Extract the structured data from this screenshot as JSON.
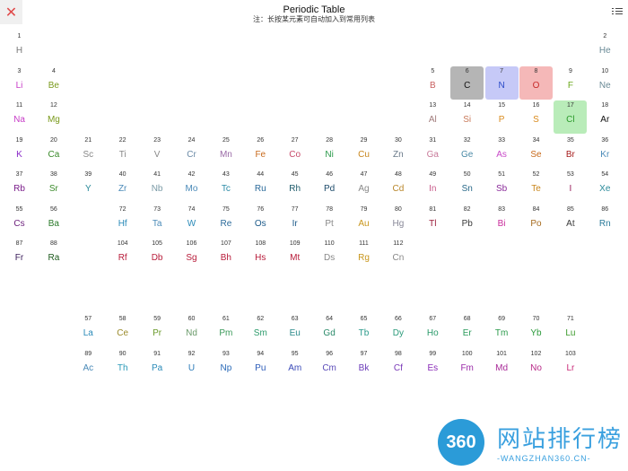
{
  "header": {
    "title": "Periodic Table",
    "subtitle": "注：长按某元素可自动加入到常用列表",
    "close_icon": "close-icon",
    "list_icon": "list-icon"
  },
  "watermark": {
    "logo_text": "360",
    "text": "网站排行榜",
    "sub": "-WANGZHAN360.CN-"
  },
  "elements": [
    {
      "n": "1",
      "s": "H",
      "row": 1,
      "col": 1,
      "color": "#777777"
    },
    {
      "n": "2",
      "s": "He",
      "row": 1,
      "col": 18,
      "color": "#6a8a96"
    },
    {
      "n": "3",
      "s": "Li",
      "row": 2,
      "col": 1,
      "color": "#c73cc7"
    },
    {
      "n": "4",
      "s": "Be",
      "row": 2,
      "col": 2,
      "color": "#7a9a1c"
    },
    {
      "n": "5",
      "s": "B",
      "row": 2,
      "col": 13,
      "color": "#c96060"
    },
    {
      "n": "6",
      "s": "C",
      "row": 2,
      "col": 14,
      "color": "#111111",
      "bg": "#b5b5b5"
    },
    {
      "n": "7",
      "s": "N",
      "row": 2,
      "col": 15,
      "color": "#2a4ac8",
      "bg": "#c6c9f7"
    },
    {
      "n": "8",
      "s": "O",
      "row": 2,
      "col": 16,
      "color": "#c82a2a",
      "bg": "#f5b8b8"
    },
    {
      "n": "9",
      "s": "F",
      "row": 2,
      "col": 17,
      "color": "#6aa81c"
    },
    {
      "n": "10",
      "s": "Ne",
      "row": 2,
      "col": 18,
      "color": "#6a8a96"
    },
    {
      "n": "11",
      "s": "Na",
      "row": 3,
      "col": 1,
      "color": "#c73cc7"
    },
    {
      "n": "12",
      "s": "Mg",
      "row": 3,
      "col": 2,
      "color": "#7a9a1c"
    },
    {
      "n": "13",
      "s": "Al",
      "row": 3,
      "col": 13,
      "color": "#a07a7a"
    },
    {
      "n": "14",
      "s": "Si",
      "row": 3,
      "col": 14,
      "color": "#c97a5a"
    },
    {
      "n": "15",
      "s": "P",
      "row": 3,
      "col": 15,
      "color": "#d98a1c"
    },
    {
      "n": "16",
      "s": "S",
      "row": 3,
      "col": 16,
      "color": "#d98a1c"
    },
    {
      "n": "17",
      "s": "Cl",
      "row": 3,
      "col": 17,
      "color": "#2a9a2a",
      "bg": "#b9ecb9"
    },
    {
      "n": "18",
      "s": "Ar",
      "row": 3,
      "col": 18,
      "color": "#111111"
    },
    {
      "n": "19",
      "s": "K",
      "row": 4,
      "col": 1,
      "color": "#8a2ac8"
    },
    {
      "n": "20",
      "s": "Ca",
      "row": 4,
      "col": 2,
      "color": "#3a8a2a"
    },
    {
      "n": "21",
      "s": "Sc",
      "row": 4,
      "col": 3,
      "color": "#888888"
    },
    {
      "n": "22",
      "s": "Ti",
      "row": 4,
      "col": 4,
      "color": "#888888"
    },
    {
      "n": "23",
      "s": "V",
      "row": 4,
      "col": 5,
      "color": "#888888"
    },
    {
      "n": "24",
      "s": "Cr",
      "row": 4,
      "col": 6,
      "color": "#6a8aa6"
    },
    {
      "n": "25",
      "s": "Mn",
      "row": 4,
      "col": 7,
      "color": "#9a6aa6"
    },
    {
      "n": "26",
      "s": "Fe",
      "row": 4,
      "col": 8,
      "color": "#c86a1c"
    },
    {
      "n": "27",
      "s": "Co",
      "row": 4,
      "col": 9,
      "color": "#c84a6a"
    },
    {
      "n": "28",
      "s": "Ni",
      "row": 4,
      "col": 10,
      "color": "#2a9a4a"
    },
    {
      "n": "29",
      "s": "Cu",
      "row": 4,
      "col": 11,
      "color": "#c8861c"
    },
    {
      "n": "30",
      "s": "Zn",
      "row": 4,
      "col": 12,
      "color": "#6a7a8a"
    },
    {
      "n": "31",
      "s": "Ga",
      "row": 4,
      "col": 13,
      "color": "#c87a9a"
    },
    {
      "n": "32",
      "s": "Ge",
      "row": 4,
      "col": 14,
      "color": "#4a8aa6"
    },
    {
      "n": "33",
      "s": "As",
      "row": 4,
      "col": 15,
      "color": "#c84ac8"
    },
    {
      "n": "34",
      "s": "Se",
      "row": 4,
      "col": 16,
      "color": "#c86a1c"
    },
    {
      "n": "35",
      "s": "Br",
      "row": 4,
      "col": 17,
      "color": "#a61c1c"
    },
    {
      "n": "36",
      "s": "Kr",
      "row": 4,
      "col": 18,
      "color": "#4a8ab8"
    },
    {
      "n": "37",
      "s": "Rb",
      "row": 5,
      "col": 1,
      "color": "#7a1c8a"
    },
    {
      "n": "38",
      "s": "Sr",
      "row": 5,
      "col": 2,
      "color": "#3a8a2a"
    },
    {
      "n": "39",
      "s": "Y",
      "row": 5,
      "col": 3,
      "color": "#2a8a9a"
    },
    {
      "n": "40",
      "s": "Zr",
      "row": 5,
      "col": 4,
      "color": "#4a8ab8"
    },
    {
      "n": "41",
      "s": "Nb",
      "row": 5,
      "col": 5,
      "color": "#7a9aa6"
    },
    {
      "n": "42",
      "s": "Mo",
      "row": 5,
      "col": 6,
      "color": "#4a8ab8"
    },
    {
      "n": "43",
      "s": "Tc",
      "row": 5,
      "col": 7,
      "color": "#2a8aa6"
    },
    {
      "n": "44",
      "s": "Ru",
      "row": 5,
      "col": 8,
      "color": "#2a6a9a"
    },
    {
      "n": "45",
      "s": "Rh",
      "row": 5,
      "col": 9,
      "color": "#1c5a6a"
    },
    {
      "n": "46",
      "s": "Pd",
      "row": 5,
      "col": 10,
      "color": "#1c4a6a"
    },
    {
      "n": "47",
      "s": "Ag",
      "row": 5,
      "col": 11,
      "color": "#888888"
    },
    {
      "n": "48",
      "s": "Cd",
      "row": 5,
      "col": 12,
      "color": "#b8862a"
    },
    {
      "n": "49",
      "s": "In",
      "row": 5,
      "col": 13,
      "color": "#c85a8a"
    },
    {
      "n": "50",
      "s": "Sn",
      "row": 5,
      "col": 14,
      "color": "#2a6a8a"
    },
    {
      "n": "51",
      "s": "Sb",
      "row": 5,
      "col": 15,
      "color": "#8a2a9a"
    },
    {
      "n": "52",
      "s": "Te",
      "row": 5,
      "col": 16,
      "color": "#c8861c"
    },
    {
      "n": "53",
      "s": "I",
      "row": 5,
      "col": 17,
      "color": "#9a1c5a"
    },
    {
      "n": "54",
      "s": "Xe",
      "row": 5,
      "col": 18,
      "color": "#2a8a9a"
    },
    {
      "n": "55",
      "s": "Cs",
      "row": 6,
      "col": 1,
      "color": "#6a1c7a"
    },
    {
      "n": "56",
      "s": "Ba",
      "row": 6,
      "col": 2,
      "color": "#2a7a2a"
    },
    {
      "n": "72",
      "s": "Hf",
      "row": 6,
      "col": 4,
      "color": "#2a8ab8"
    },
    {
      "n": "73",
      "s": "Ta",
      "row": 6,
      "col": 5,
      "color": "#4a8ab8"
    },
    {
      "n": "74",
      "s": "W",
      "row": 6,
      "col": 6,
      "color": "#2a8ab8"
    },
    {
      "n": "75",
      "s": "Re",
      "row": 6,
      "col": 7,
      "color": "#2a6a9a"
    },
    {
      "n": "76",
      "s": "Os",
      "row": 6,
      "col": 8,
      "color": "#1c5a8a"
    },
    {
      "n": "77",
      "s": "Ir",
      "row": 6,
      "col": 9,
      "color": "#1c5a8a"
    },
    {
      "n": "78",
      "s": "Pt",
      "row": 6,
      "col": 10,
      "color": "#888888"
    },
    {
      "n": "79",
      "s": "Au",
      "row": 6,
      "col": 11,
      "color": "#c8961c"
    },
    {
      "n": "80",
      "s": "Hg",
      "row": 6,
      "col": 12,
      "color": "#888898"
    },
    {
      "n": "81",
      "s": "Tl",
      "row": 6,
      "col": 13,
      "color": "#9a1c3a"
    },
    {
      "n": "82",
      "s": "Pb",
      "row": 6,
      "col": 14,
      "color": "#3a3a3a"
    },
    {
      "n": "83",
      "s": "Bi",
      "row": 6,
      "col": 15,
      "color": "#c82a9a"
    },
    {
      "n": "84",
      "s": "Po",
      "row": 6,
      "col": 16,
      "color": "#a66a1c"
    },
    {
      "n": "85",
      "s": "At",
      "row": 6,
      "col": 17,
      "color": "#3a3a3a"
    },
    {
      "n": "86",
      "s": "Rn",
      "row": 6,
      "col": 18,
      "color": "#2a7a9a"
    },
    {
      "n": "87",
      "s": "Fr",
      "row": 7,
      "col": 1,
      "color": "#3a1c5a"
    },
    {
      "n": "88",
      "s": "Ra",
      "row": 7,
      "col": 2,
      "color": "#1c5a1c"
    },
    {
      "n": "104",
      "s": "Rf",
      "row": 7,
      "col": 4,
      "color": "#b81c3a"
    },
    {
      "n": "105",
      "s": "Db",
      "row": 7,
      "col": 5,
      "color": "#b81c3a"
    },
    {
      "n": "106",
      "s": "Sg",
      "row": 7,
      "col": 6,
      "color": "#b81c3a"
    },
    {
      "n": "107",
      "s": "Bh",
      "row": 7,
      "col": 7,
      "color": "#b81c3a"
    },
    {
      "n": "108",
      "s": "Hs",
      "row": 7,
      "col": 8,
      "color": "#b81c3a"
    },
    {
      "n": "109",
      "s": "Mt",
      "row": 7,
      "col": 9,
      "color": "#b81c3a"
    },
    {
      "n": "110",
      "s": "Ds",
      "row": 7,
      "col": 10,
      "color": "#888888"
    },
    {
      "n": "111",
      "s": "Rg",
      "row": 7,
      "col": 11,
      "color": "#c8961c"
    },
    {
      "n": "112",
      "s": "Cn",
      "row": 7,
      "col": 12,
      "color": "#888888"
    },
    {
      "n": "57",
      "s": "La",
      "row": 9,
      "col": 3,
      "color": "#2a8ab8"
    },
    {
      "n": "58",
      "s": "Ce",
      "row": 9,
      "col": 4,
      "color": "#9a8a2a"
    },
    {
      "n": "59",
      "s": "Pr",
      "row": 9,
      "col": 5,
      "color": "#6a9a2a"
    },
    {
      "n": "60",
      "s": "Nd",
      "row": 9,
      "col": 6,
      "color": "#6a9a6a"
    },
    {
      "n": "61",
      "s": "Pm",
      "row": 9,
      "col": 7,
      "color": "#3a9a5a"
    },
    {
      "n": "62",
      "s": "Sm",
      "row": 9,
      "col": 8,
      "color": "#2a9a6a"
    },
    {
      "n": "63",
      "s": "Eu",
      "row": 9,
      "col": 9,
      "color": "#2a8a8a"
    },
    {
      "n": "64",
      "s": "Gd",
      "row": 9,
      "col": 10,
      "color": "#2a8a6a"
    },
    {
      "n": "65",
      "s": "Tb",
      "row": 9,
      "col": 11,
      "color": "#2a9a8a"
    },
    {
      "n": "66",
      "s": "Dy",
      "row": 9,
      "col": 12,
      "color": "#2a9a7a"
    },
    {
      "n": "67",
      "s": "Ho",
      "row": 9,
      "col": 13,
      "color": "#2a9a6a"
    },
    {
      "n": "68",
      "s": "Er",
      "row": 9,
      "col": 14,
      "color": "#2a9a5a"
    },
    {
      "n": "69",
      "s": "Tm",
      "row": 9,
      "col": 15,
      "color": "#2a9a4a"
    },
    {
      "n": "70",
      "s": "Yb",
      "row": 9,
      "col": 16,
      "color": "#2a9a3a"
    },
    {
      "n": "71",
      "s": "Lu",
      "row": 9,
      "col": 17,
      "color": "#3a9a2a"
    },
    {
      "n": "89",
      "s": "Ac",
      "row": 10,
      "col": 3,
      "color": "#4a8ab8"
    },
    {
      "n": "90",
      "s": "Th",
      "row": 10,
      "col": 4,
      "color": "#2a9ab8"
    },
    {
      "n": "91",
      "s": "Pa",
      "row": 10,
      "col": 5,
      "color": "#2a8ab8"
    },
    {
      "n": "92",
      "s": "U",
      "row": 10,
      "col": 6,
      "color": "#2a7ab8"
    },
    {
      "n": "93",
      "s": "Np",
      "row": 10,
      "col": 7,
      "color": "#2a6ab8"
    },
    {
      "n": "94",
      "s": "Pu",
      "row": 10,
      "col": 8,
      "color": "#2a5ab8"
    },
    {
      "n": "95",
      "s": "Am",
      "row": 10,
      "col": 9,
      "color": "#3a4ab8"
    },
    {
      "n": "96",
      "s": "Cm",
      "row": 10,
      "col": 10,
      "color": "#5a4ab8"
    },
    {
      "n": "97",
      "s": "Bk",
      "row": 10,
      "col": 11,
      "color": "#6a3ab8"
    },
    {
      "n": "98",
      "s": "Cf",
      "row": 10,
      "col": 12,
      "color": "#7a3ab8"
    },
    {
      "n": "99",
      "s": "Es",
      "row": 10,
      "col": 13,
      "color": "#8a2ab8"
    },
    {
      "n": "100",
      "s": "Fm",
      "row": 10,
      "col": 14,
      "color": "#9a2aa8"
    },
    {
      "n": "101",
      "s": "Md",
      "row": 10,
      "col": 15,
      "color": "#a82a98"
    },
    {
      "n": "102",
      "s": "No",
      "row": 10,
      "col": 16,
      "color": "#b82a88"
    },
    {
      "n": "103",
      "s": "Lr",
      "row": 10,
      "col": 17,
      "color": "#c82a78"
    }
  ]
}
